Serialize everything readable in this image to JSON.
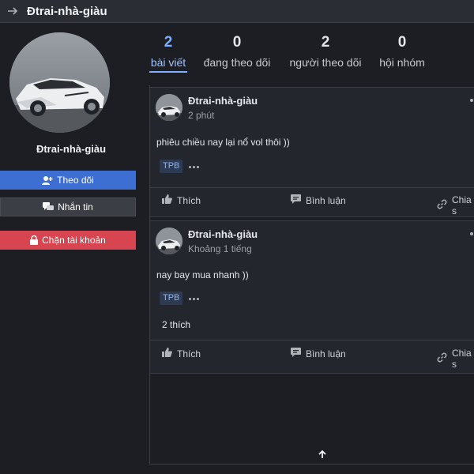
{
  "header": {
    "title": "Đtrai-nhà-giàu",
    "back_icon": "arrow-right-icon"
  },
  "profile": {
    "name": "Đtrai-nhà-giàu",
    "avatar": "sports-car-photo",
    "follow_label": "Theo dõi",
    "message_label": "Nhắn tin",
    "block_label": "Chặn tài khoản",
    "colors": {
      "follow": "#3c6fd1",
      "block": "#d64550"
    }
  },
  "stats": [
    {
      "value": "2",
      "label": "bài viết",
      "active": true
    },
    {
      "value": "0",
      "label": "đang theo dõi",
      "active": false
    },
    {
      "value": "2",
      "label": "người theo dõi",
      "active": false
    },
    {
      "value": "0",
      "label": "hội nhóm",
      "active": false
    }
  ],
  "posts": [
    {
      "author": "Đtrai-nhà-giàu",
      "time": "2 phút",
      "text": "phiêu chiều nay lại nổ vol thôi ))",
      "tag": "TPB",
      "likes": "",
      "actions": {
        "like": "Thích",
        "comment": "Bình luận",
        "share": "Chia s"
      }
    },
    {
      "author": "Đtrai-nhà-giàu",
      "time": "Khoảng 1 tiếng",
      "text": "nay bay mua nhanh ))",
      "tag": "TPB",
      "likes": "2 thích",
      "actions": {
        "like": "Thích",
        "comment": "Bình luận",
        "share": "Chia s"
      }
    }
  ],
  "scroll_top_icon": "arrow-up-icon"
}
